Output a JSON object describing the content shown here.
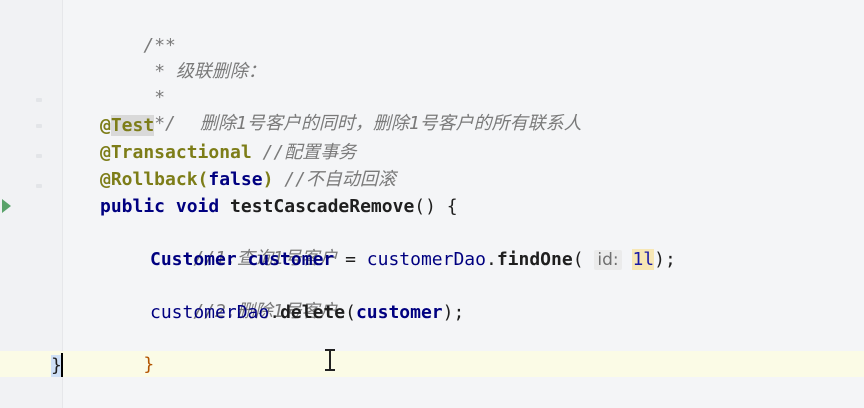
{
  "editor": {
    "lines": {
      "l1": "/**",
      "l2": " * 级联删除：",
      "l3_prefix": " *",
      "l3_text": "删除1号客户的同时，删除1号客户的所有联系人",
      "l4": " */",
      "l5_at": "@",
      "l5_name": "Test",
      "l6_ann": "@Transactional",
      "l6_comment": " //配置事务",
      "l7_ann": "@Rollback(",
      "l7_arg": "false",
      "l7_close": ")",
      "l7_comment": " //不自动回滚",
      "l8_kw": "public void ",
      "l8_fn": "testCascadeRemove",
      "l8_rest": "() {",
      "l9": "//1.查询1号客户",
      "l10_type": "Customer ",
      "l10_var": "customer",
      "l10_eq": " = ",
      "l10_dao": "customerDao",
      "l10_dot": ".",
      "l10_fn": "findOne",
      "l10_open": "( ",
      "l10_hint": "id:",
      "l10_num": "1l",
      "l10_close": ");",
      "l11": "//2.删除1号客户",
      "l12_dao": "customerDao",
      "l12_dot": ".",
      "l12_fn": "delete",
      "l12_open": "(",
      "l12_arg": "customer",
      "l12_close": ");",
      "l13": "}",
      "l14": "}"
    }
  }
}
